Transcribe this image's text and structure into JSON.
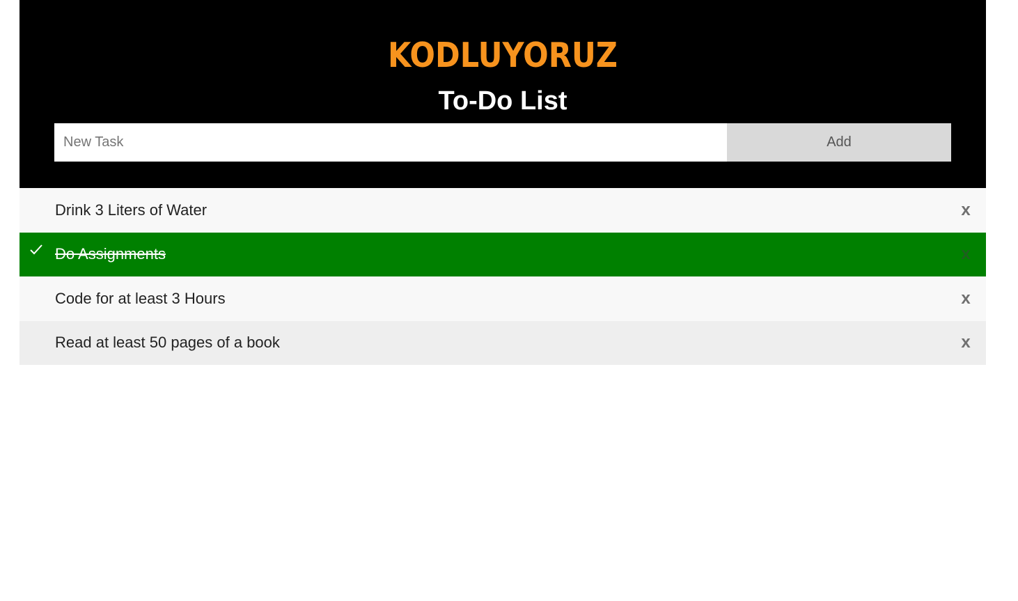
{
  "header": {
    "logo_text": "KODLUYORUZ",
    "title": "To-Do List"
  },
  "form": {
    "input_placeholder": "New Task",
    "input_value": "",
    "add_label": "Add"
  },
  "tasks": [
    {
      "text": "Drink 3 Liters of Water",
      "checked": false,
      "close": "x"
    },
    {
      "text": "Do Assignments",
      "checked": true,
      "close": "x"
    },
    {
      "text": "Code for at least 3 Hours",
      "checked": false,
      "close": "x"
    },
    {
      "text": "Read at least 50 pages of a book",
      "checked": false,
      "close": "x"
    }
  ],
  "icons": {
    "check": "check-icon",
    "close": "close-icon"
  },
  "colors": {
    "header_bg": "#000000",
    "logo": "#f7931e",
    "checked_bg": "#008000",
    "add_button_bg": "#d9d9d9"
  }
}
